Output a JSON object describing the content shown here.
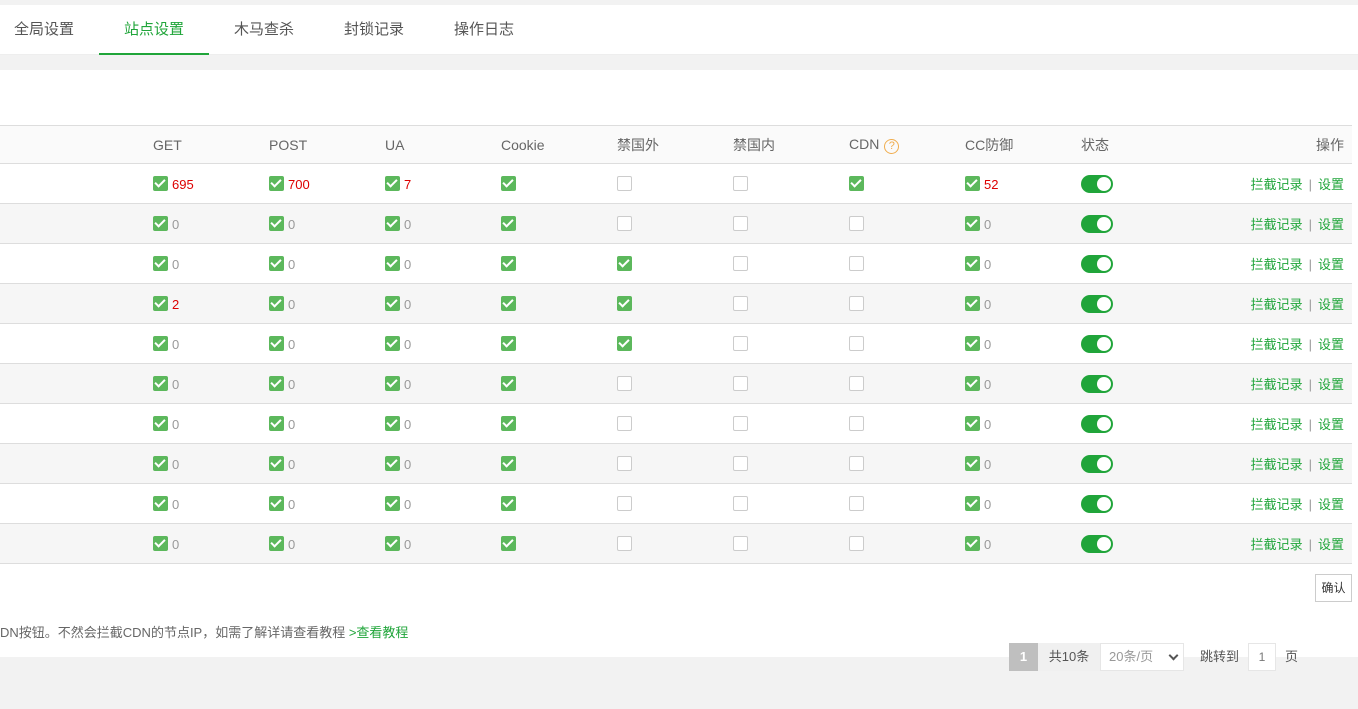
{
  "tabs": [
    {
      "label": "全局设置",
      "active": false
    },
    {
      "label": "站点设置",
      "active": true
    },
    {
      "label": "木马查杀",
      "active": false
    },
    {
      "label": "封锁记录",
      "active": false
    },
    {
      "label": "操作日志",
      "active": false
    }
  ],
  "table": {
    "headers": {
      "get": "GET",
      "post": "POST",
      "ua": "UA",
      "cookie": "Cookie",
      "ban_foreign": "禁国外",
      "ban_domestic": "禁国内",
      "cdn": "CDN",
      "cdn_help_icon": "?",
      "cc": "CC防御",
      "state": "状态",
      "ops": "操作"
    },
    "link_records": "拦截记录",
    "link_separator": "|",
    "link_settings": "设置",
    "rows": [
      {
        "get": {
          "on": true,
          "count": "695"
        },
        "post": {
          "on": true,
          "count": "700"
        },
        "ua": {
          "on": true,
          "count": "7"
        },
        "cookie": true,
        "ban_foreign": false,
        "ban_domestic": false,
        "cdn": true,
        "cc": {
          "on": true,
          "count": "52"
        },
        "state": true
      },
      {
        "get": {
          "on": true,
          "count": "0"
        },
        "post": {
          "on": true,
          "count": "0"
        },
        "ua": {
          "on": true,
          "count": "0"
        },
        "cookie": true,
        "ban_foreign": false,
        "ban_domestic": false,
        "cdn": false,
        "cc": {
          "on": true,
          "count": "0"
        },
        "state": true
      },
      {
        "get": {
          "on": true,
          "count": "0"
        },
        "post": {
          "on": true,
          "count": "0"
        },
        "ua": {
          "on": true,
          "count": "0"
        },
        "cookie": true,
        "ban_foreign": true,
        "ban_domestic": false,
        "cdn": false,
        "cc": {
          "on": true,
          "count": "0"
        },
        "state": true
      },
      {
        "get": {
          "on": true,
          "count": "2"
        },
        "post": {
          "on": true,
          "count": "0"
        },
        "ua": {
          "on": true,
          "count": "0"
        },
        "cookie": true,
        "ban_foreign": true,
        "ban_domestic": false,
        "cdn": false,
        "cc": {
          "on": true,
          "count": "0"
        },
        "state": true
      },
      {
        "get": {
          "on": true,
          "count": "0"
        },
        "post": {
          "on": true,
          "count": "0"
        },
        "ua": {
          "on": true,
          "count": "0"
        },
        "cookie": true,
        "ban_foreign": true,
        "ban_domestic": false,
        "cdn": false,
        "cc": {
          "on": true,
          "count": "0"
        },
        "state": true
      },
      {
        "get": {
          "on": true,
          "count": "0"
        },
        "post": {
          "on": true,
          "count": "0"
        },
        "ua": {
          "on": true,
          "count": "0"
        },
        "cookie": true,
        "ban_foreign": false,
        "ban_domestic": false,
        "cdn": false,
        "cc": {
          "on": true,
          "count": "0"
        },
        "state": true
      },
      {
        "get": {
          "on": true,
          "count": "0"
        },
        "post": {
          "on": true,
          "count": "0"
        },
        "ua": {
          "on": true,
          "count": "0"
        },
        "cookie": true,
        "ban_foreign": false,
        "ban_domestic": false,
        "cdn": false,
        "cc": {
          "on": true,
          "count": "0"
        },
        "state": true
      },
      {
        "get": {
          "on": true,
          "count": "0"
        },
        "post": {
          "on": true,
          "count": "0"
        },
        "ua": {
          "on": true,
          "count": "0"
        },
        "cookie": true,
        "ban_foreign": false,
        "ban_domestic": false,
        "cdn": false,
        "cc": {
          "on": true,
          "count": "0"
        },
        "state": true
      },
      {
        "get": {
          "on": true,
          "count": "0"
        },
        "post": {
          "on": true,
          "count": "0"
        },
        "ua": {
          "on": true,
          "count": "0"
        },
        "cookie": true,
        "ban_foreign": false,
        "ban_domestic": false,
        "cdn": false,
        "cc": {
          "on": true,
          "count": "0"
        },
        "state": true
      },
      {
        "get": {
          "on": true,
          "count": "0"
        },
        "post": {
          "on": true,
          "count": "0"
        },
        "ua": {
          "on": true,
          "count": "0"
        },
        "cookie": true,
        "ban_foreign": false,
        "ban_domestic": false,
        "cdn": false,
        "cc": {
          "on": true,
          "count": "0"
        },
        "state": true
      }
    ]
  },
  "pager": {
    "current_page": "1",
    "total": "共10条",
    "page_size": "20条/页",
    "jump_label": "跳转到",
    "jump_value": "1",
    "page_unit": "页",
    "confirm": "确认"
  },
  "note": {
    "text": "DN按钮。不然会拦截CDN的节点IP，如需了解详请查看教程 ",
    "link": ">查看教程"
  },
  "colors": {
    "accent": "#20a53a",
    "checkbox_on": "#5cb85c",
    "count_nonzero": "#dd0000",
    "help_icon": "#f0ad4e"
  }
}
